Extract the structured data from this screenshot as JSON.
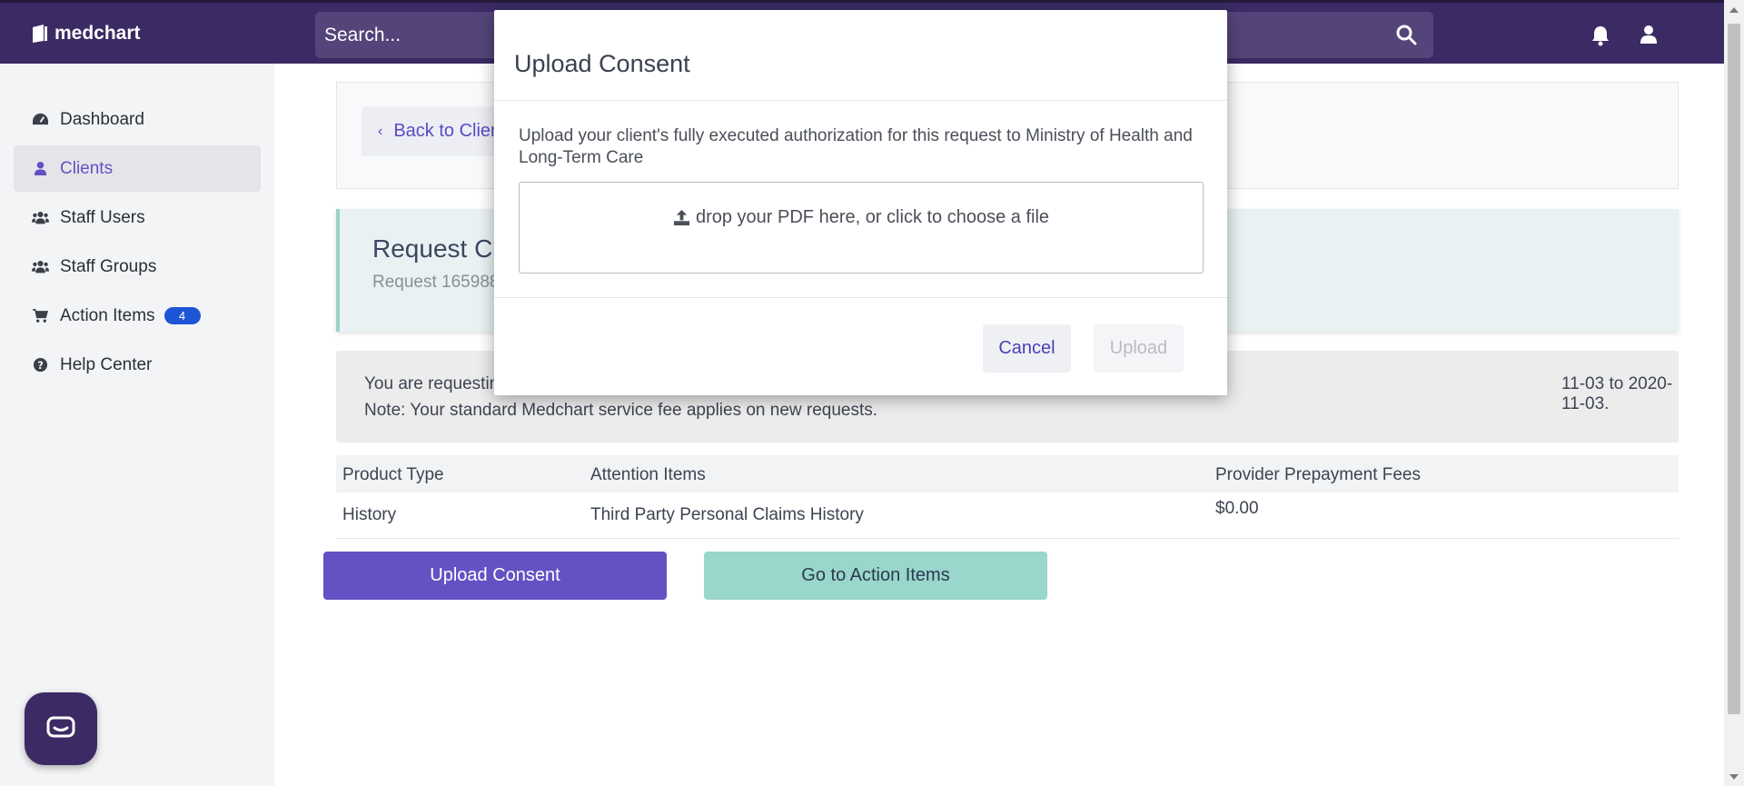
{
  "topbar": {
    "logo_text": "medchart",
    "search_placeholder": "Search...",
    "icons": [
      "search-icon",
      "bell-icon",
      "user-icon"
    ]
  },
  "sidebar": {
    "items": [
      {
        "label": "Dashboard",
        "icon": "dashboard-icon",
        "active": false
      },
      {
        "label": "Clients",
        "icon": "user-icon",
        "active": true
      },
      {
        "label": "Staff Users",
        "icon": "users-icon",
        "active": false
      },
      {
        "label": "Staff Groups",
        "icon": "users-icon",
        "active": false
      },
      {
        "label": "Action Items",
        "icon": "cart-icon",
        "active": false,
        "badge": "4"
      },
      {
        "label": "Help Center",
        "icon": "help-icon",
        "active": false
      }
    ]
  },
  "main": {
    "back_label": "Back to Clien",
    "request_title": "Request Cr",
    "request_subtitle": "Request 165988",
    "notice_line1_start": "You are requestin",
    "notice_line1_end": "11-03 to 2020-11-03.",
    "notice_line2": "Note: Your standard Medchart service fee applies on new requests.",
    "table": {
      "headers": [
        "Product Type",
        "Attention Items",
        "Provider Prepayment Fees"
      ],
      "rows": [
        [
          "History",
          "Third Party Personal Claims History",
          "$0.00"
        ]
      ]
    },
    "upload_consent_label": "Upload Consent",
    "go_to_action_items_label": "Go to Action Items"
  },
  "modal": {
    "title": "Upload Consent",
    "description": "Upload your client's fully executed authorization for this request to Ministry of Health and Long-Term Care",
    "dropzone_text": "drop your PDF here, or click to choose a file",
    "cancel_label": "Cancel",
    "upload_label": "Upload"
  },
  "colors": {
    "topbar": "#3b2a64",
    "accent": "#6551c3",
    "teal": "#99d6cc",
    "badge": "#1e55d6"
  }
}
